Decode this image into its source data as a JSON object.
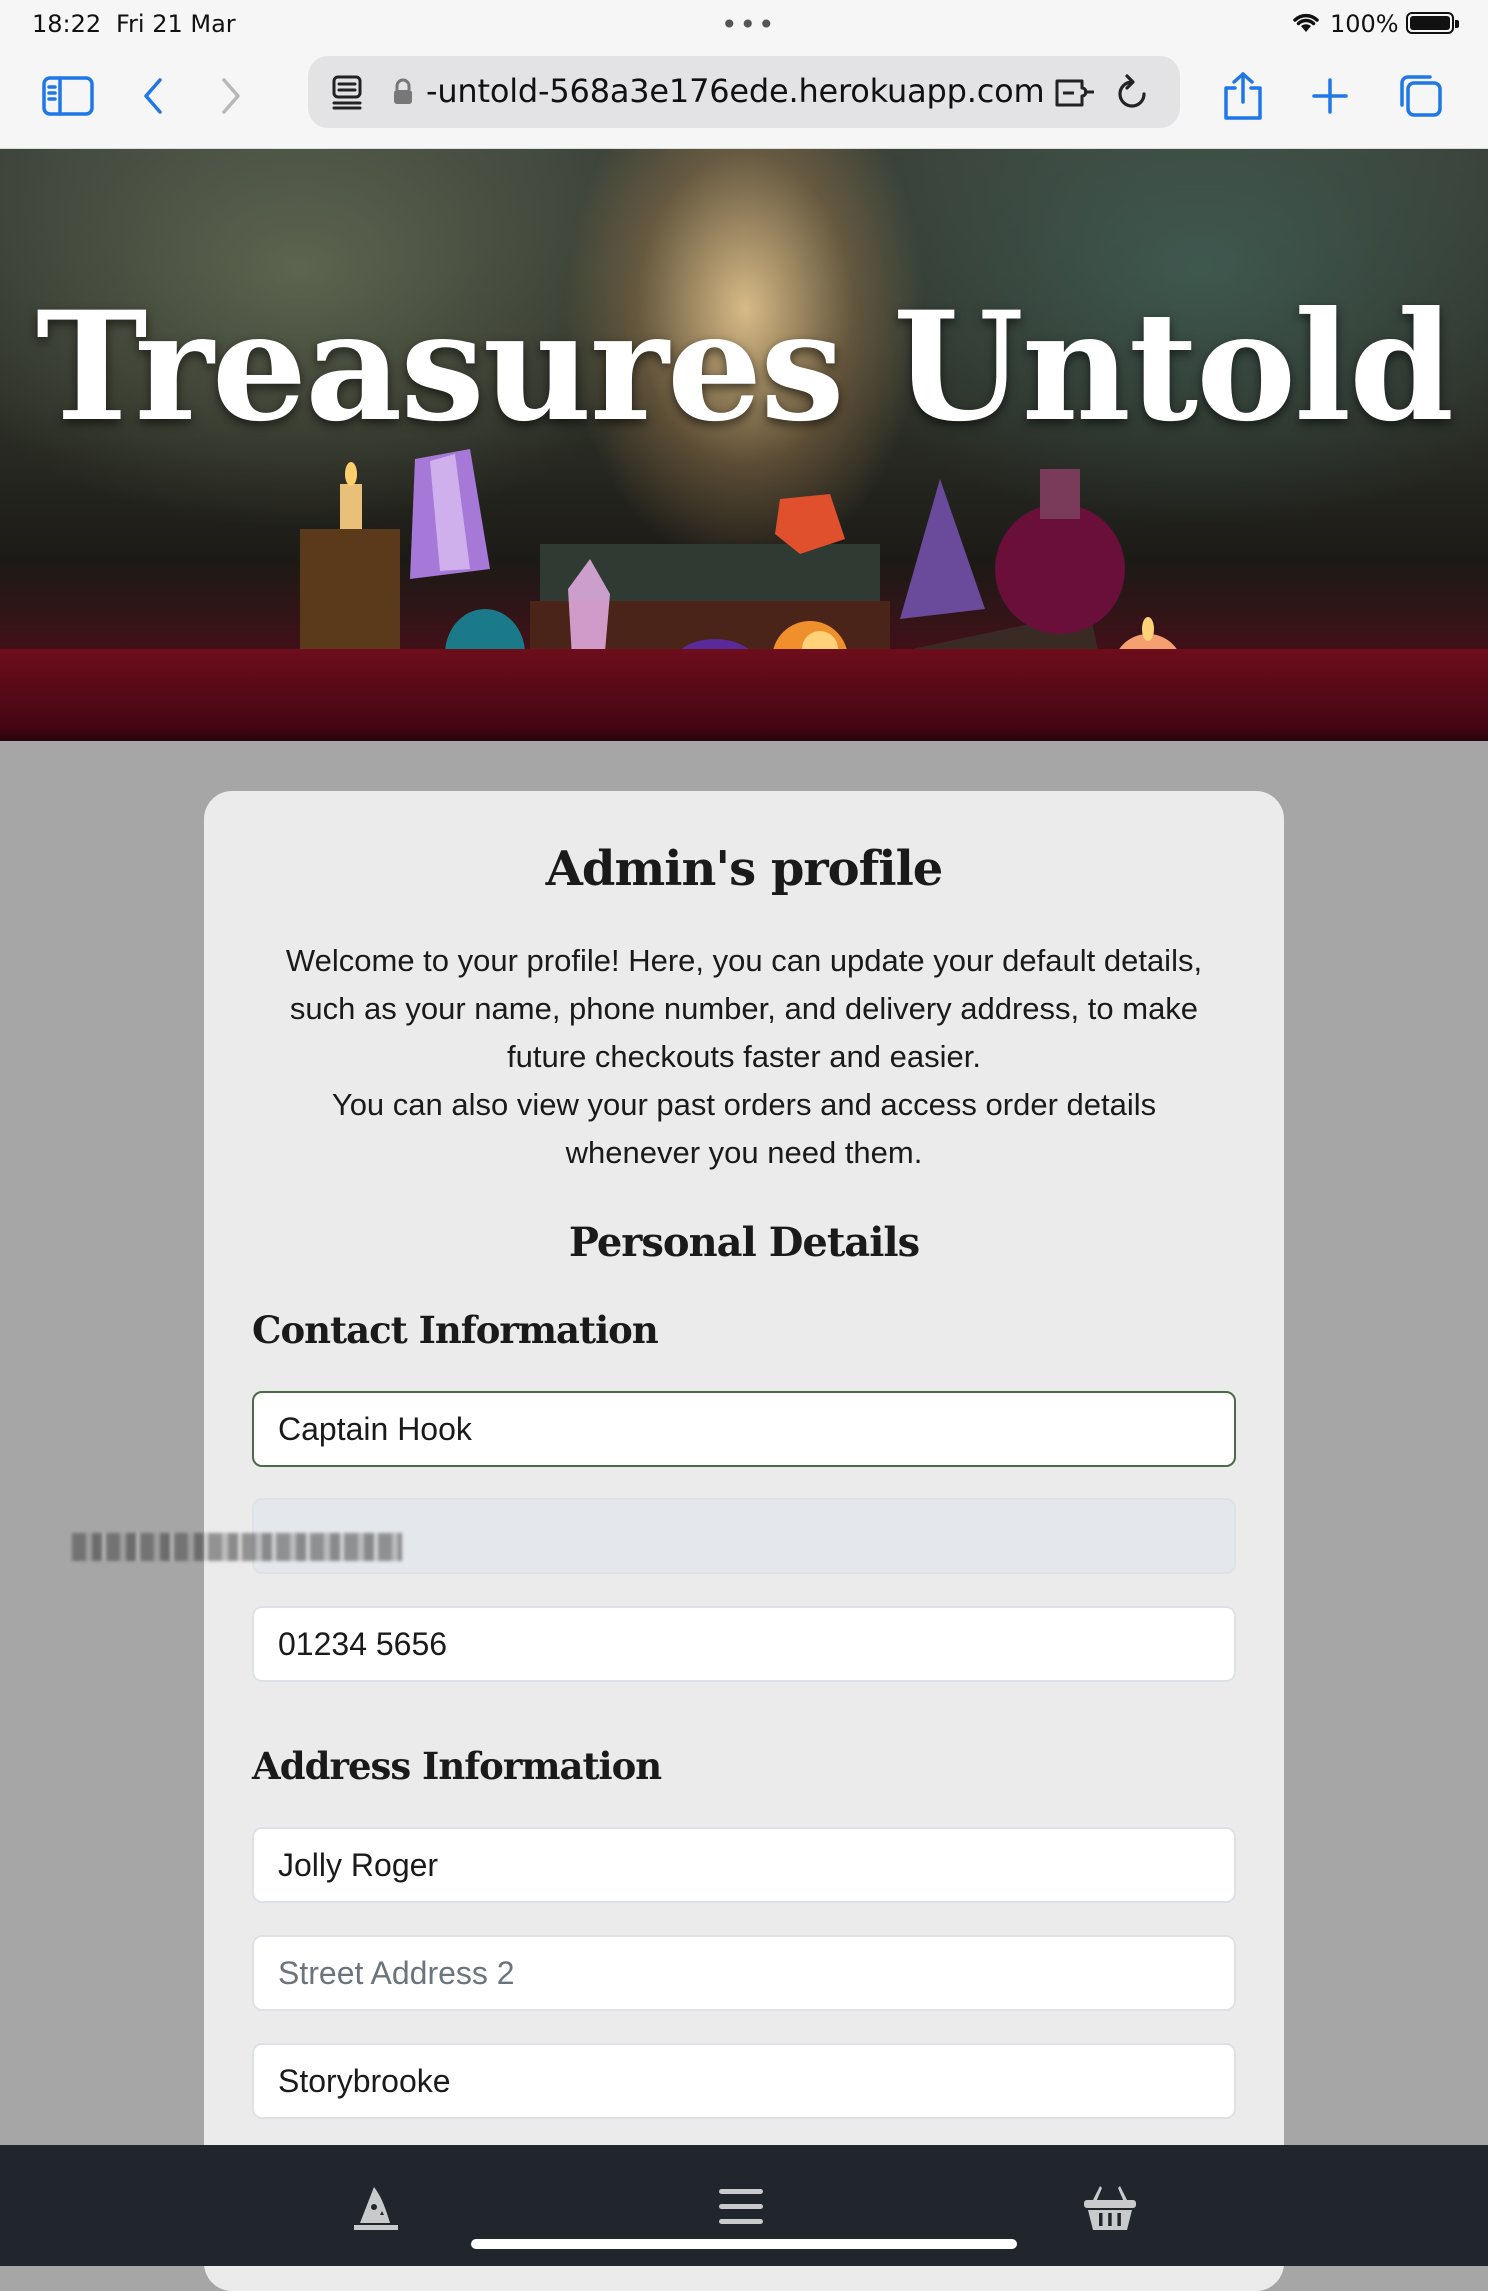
{
  "status_bar": {
    "time": "18:22",
    "date": "Fri 21 Mar",
    "battery": "100%"
  },
  "browser": {
    "url": "-untold-568a3e176ede.herokuapp.com",
    "icons": [
      "sidebar-icon",
      "back-icon",
      "forward-icon",
      "reader-icon",
      "lock-icon",
      "extension-icon",
      "reload-icon",
      "share-icon",
      "new-tab-icon",
      "tabs-icon"
    ]
  },
  "hero": {
    "title": "Treasures Untold"
  },
  "profile": {
    "heading": "Admin's profile",
    "intro_line1": "Welcome to your profile! Here, you can update your default details,",
    "intro_line2": "such as your name, phone number, and delivery address, to make",
    "intro_line3": "future checkouts faster and easier.",
    "intro_line4": "You can also view your past orders and access order details",
    "intro_line5": "whenever you need them.",
    "personal_details": "Personal Details",
    "contact_heading": "Contact Information",
    "full_name": "Captain Hook",
    "phone": "01234 5656",
    "address_heading": "Address Information",
    "street1": "Jolly Roger",
    "street2_placeholder": "Street Address 2",
    "town": "Storybrooke"
  },
  "bottom_nav": {
    "icons": [
      "wizard-hat-icon",
      "menu-icon",
      "basket-icon"
    ]
  },
  "colors": {
    "page_bg": "#a6a6a6",
    "card_bg": "#ebebeb",
    "nav_bg": "#20262b",
    "accent_blue": "#1f77e8",
    "focus_border": "#4a6b45"
  }
}
